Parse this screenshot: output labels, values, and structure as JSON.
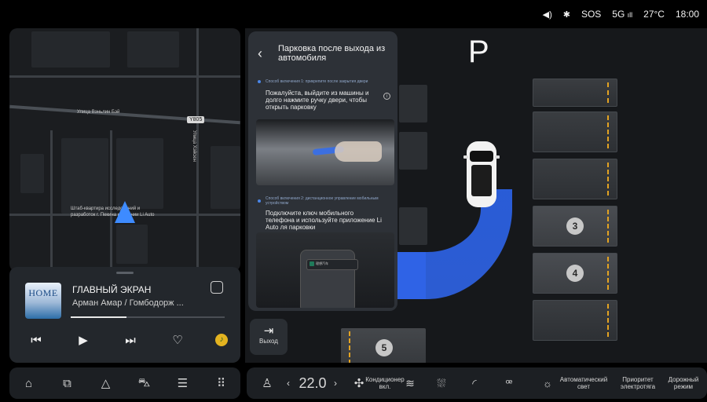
{
  "status_bar": {
    "volume_icon": "volume-icon",
    "bluetooth_icon": "bluetooth-icon",
    "sos": "SOS",
    "signal": "5G",
    "temperature": "27°C",
    "time": "18:00"
  },
  "map": {
    "street_1": "Улица Вэньлин Бэй",
    "street_2": "Улица Хэйсюн",
    "road_badge": "Y805",
    "poi": "Штаб-квартира исследований и разработок г. Пекина компании Li Auto"
  },
  "music": {
    "album_text": "HOME",
    "title": "ГЛАВНЫЙ ЭКРАН",
    "artist": "Арман Амар / Гомбодорж ...",
    "progress": 0.36,
    "mode_icon_text": "Список треков"
  },
  "scene": {
    "gear": "P",
    "slot_3": "3",
    "slot_4": "4",
    "slot_5": "5"
  },
  "guide": {
    "title": "Парковка после выхода из автомобиля",
    "mode1_label": "Способ включения 1: прикрепите после закрытия двери",
    "mode1_text": "Пожалуйста, выйдите из машины и долго нажмите ручку двери, чтобы открыть парковку",
    "mode2_label": "Способ включения 2: дистанционное управление мобильным устройством",
    "mode2_text": "Подключите ключ мобильного телефона и используйте приложение Li Auto ля парковки",
    "phone_notif": "理想汽车"
  },
  "exit": {
    "label": "Выход"
  },
  "climate": {
    "temperature": "22.0",
    "fan_label": "Кондиционер вкл.",
    "auto_light": "Автоматический свет",
    "power_priority": "Приоритет электротяга",
    "road_mode": "Дорожный режим"
  },
  "colors": {
    "accent_blue": "#2f63e6",
    "parking_line": "#e3a322"
  }
}
